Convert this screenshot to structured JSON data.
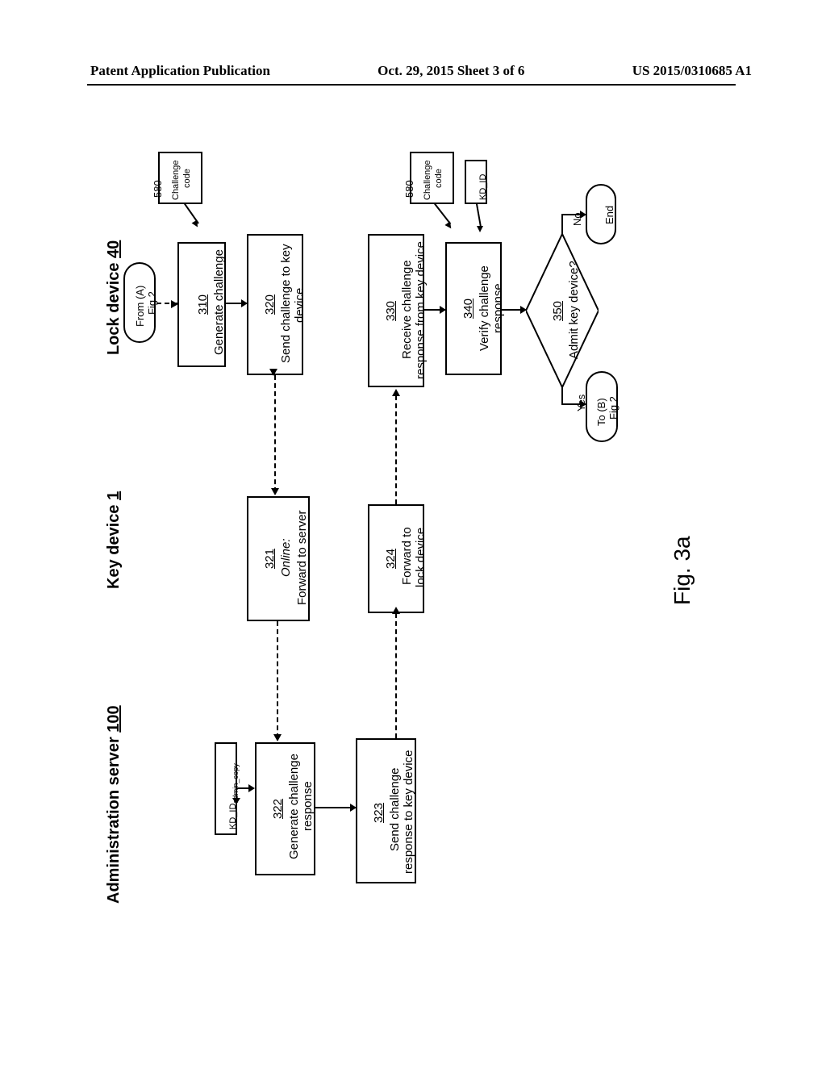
{
  "header": {
    "left": "Patent Application Publication",
    "middle": "Oct. 29, 2015  Sheet 3 of 6",
    "right": "US 2015/0310685 A1"
  },
  "figure_label": "Fig. 3a",
  "columns": {
    "admin": {
      "title": "Administration server ",
      "ref": "100"
    },
    "key": {
      "title": "Key device ",
      "ref": "1"
    },
    "lock": {
      "title": "Lock device ",
      "ref": "40"
    }
  },
  "lock": {
    "from": {
      "line1": "From (A)",
      "line2": "Fig 2"
    },
    "b310": {
      "num": "310",
      "text": "Generate challenge"
    },
    "b320": {
      "num": "320",
      "text1": "Send challenge to key",
      "text2": "device"
    },
    "b330": {
      "num": "330",
      "text1": "Receive challenge",
      "text2": "response from key device"
    },
    "b340": {
      "num": "340",
      "text1": "Verify challenge",
      "text2": "response"
    },
    "d350": {
      "num": "350",
      "text": "Admit key device?"
    },
    "yes": "Yes",
    "no": "No",
    "end": "End",
    "to": {
      "line1": "To (B)",
      "line2": "Fig 2"
    },
    "chal580a": {
      "num": "580",
      "text1": "Challenge",
      "text2": "code"
    },
    "chal580b": {
      "num": "580",
      "text1": "Challenge",
      "text2": "code"
    },
    "kdid": "KD_ID"
  },
  "key": {
    "b321": {
      "num": "321",
      "online": "Online:",
      "text": "Forward to server"
    },
    "b324": {
      "num": "324",
      "text1": "Forward to",
      "text2": "lock device"
    }
  },
  "admin": {
    "kdid_copy_label": "KD_ID",
    "kdid_copy_sub": "admin_copy",
    "b322": {
      "num": "322",
      "text1": "Generate challenge",
      "text2": "response"
    },
    "b323": {
      "num": "323",
      "text1": "Send challenge",
      "text2": "response to key device"
    }
  }
}
